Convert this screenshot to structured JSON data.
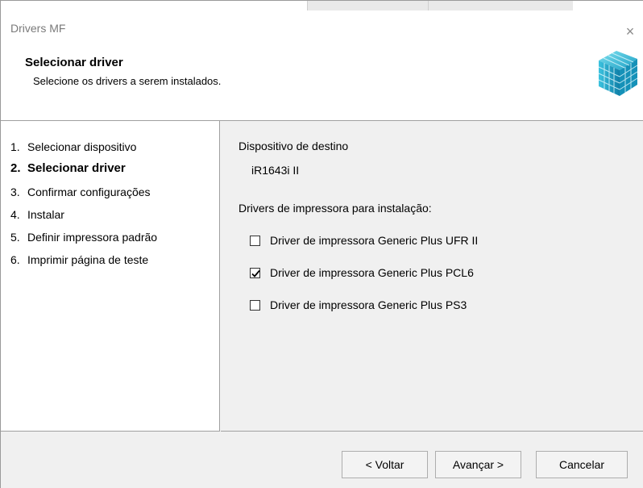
{
  "window": {
    "title": "Drivers MF",
    "close_glyph": "×"
  },
  "header": {
    "title": "Selecionar driver",
    "subtitle": "Selecione os drivers a serem instalados.",
    "icon": "cube-stack-icon"
  },
  "steps": [
    {
      "num": "1.",
      "label": "Selecionar dispositivo",
      "active": false
    },
    {
      "num": "2.",
      "label": "Selecionar driver",
      "active": true
    },
    {
      "num": "3.",
      "label": "Confirmar configurações",
      "active": false
    },
    {
      "num": "4.",
      "label": "Instalar",
      "active": false
    },
    {
      "num": "5.",
      "label": "Definir impressora padrão",
      "active": false
    },
    {
      "num": "6.",
      "label": "Imprimir página de teste",
      "active": false
    }
  ],
  "content": {
    "device_label": "Dispositivo de destino",
    "device_value": "iR1643i II",
    "drivers_label": "Drivers de impressora para instalação:",
    "drivers": [
      {
        "label": "Driver de impressora Generic Plus UFR II",
        "checked": false
      },
      {
        "label": "Driver de impressora Generic Plus PCL6",
        "checked": true
      },
      {
        "label": "Driver de impressora Generic Plus PS3",
        "checked": false
      }
    ]
  },
  "buttons": {
    "back": "< Voltar",
    "next": "Avançar >",
    "cancel": "Cancelar"
  },
  "colors": {
    "window_bg": "#f0f0f0",
    "pane_bg": "#ffffff",
    "icon_cyan": "#2bb7d6"
  }
}
